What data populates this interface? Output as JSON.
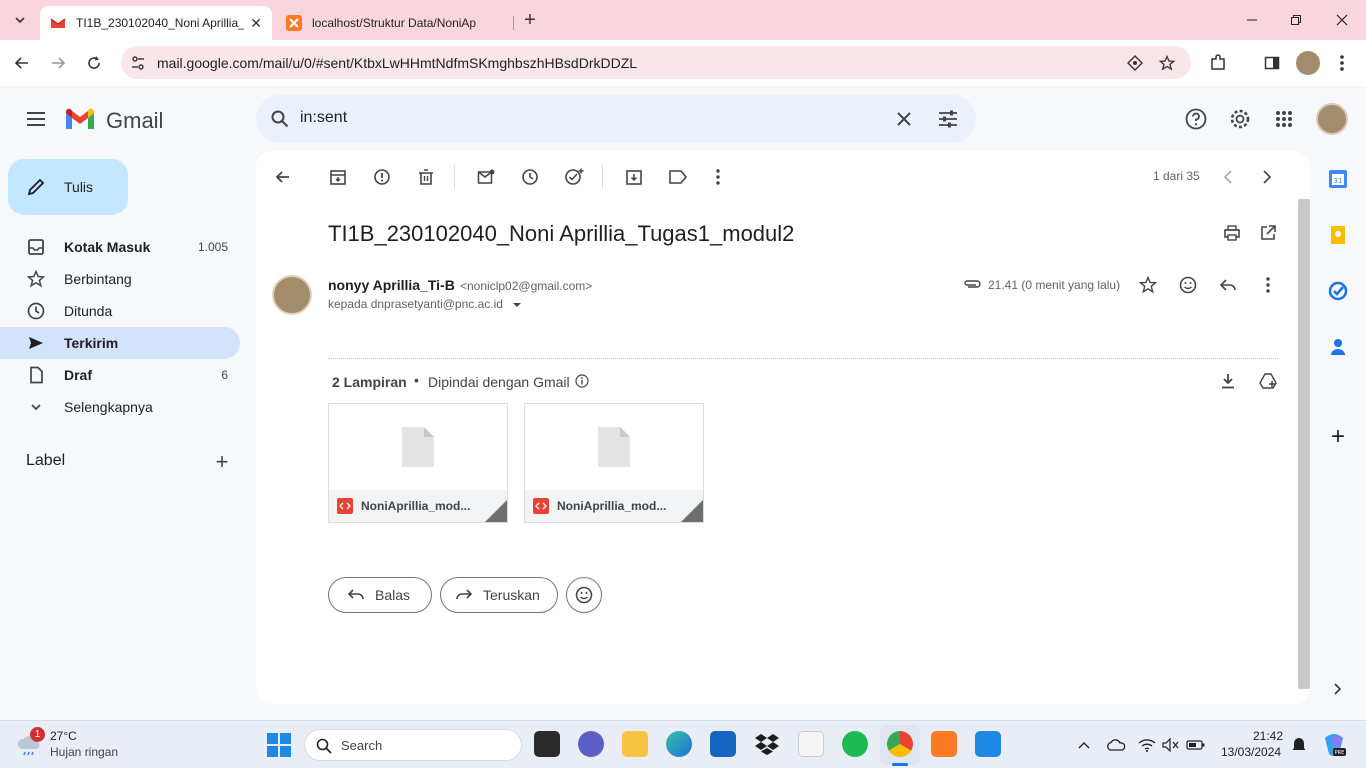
{
  "browser": {
    "tabs": [
      {
        "title": "TI1B_230102040_Noni Aprillia_T",
        "active": true
      },
      {
        "title": "localhost/Struktur Data/NoniAp",
        "active": false
      }
    ],
    "url": "mail.google.com/mail/u/0/#sent/KtbxLwHHmtNdfmSKmghbszhHBsdDrkDDZL"
  },
  "gmail": {
    "logo_text": "Gmail",
    "search_value": "in:sent",
    "compose_label": "Tulis",
    "nav": [
      {
        "label": "Kotak Masuk",
        "count": "1.005",
        "icon": "inbox-icon",
        "selected": false
      },
      {
        "label": "Berbintang",
        "count": "",
        "icon": "star-icon",
        "selected": false
      },
      {
        "label": "Ditunda",
        "count": "",
        "icon": "clock-icon",
        "selected": false
      },
      {
        "label": "Terkirim",
        "count": "",
        "icon": "send-icon",
        "selected": true
      },
      {
        "label": "Draf",
        "count": "6",
        "icon": "draft-icon",
        "selected": false
      },
      {
        "label": "Selengkapnya",
        "count": "",
        "icon": "chevron-down-icon",
        "selected": false
      }
    ],
    "labels_heading": "Label",
    "pager": "1 dari 35",
    "message": {
      "subject": "TI1B_230102040_Noni Aprillia_Tugas1_modul2",
      "sender_name": "nonyy Aprillia_Ti-B",
      "sender_email": "<noniclp02@gmail.com>",
      "to_line": "kepada dnprasetyanti@pnc.ac.id",
      "time": "21.41 (0 menit yang lalu)",
      "attachments_title": "2 Lampiran",
      "scanned_text": "Dipindai dengan Gmail",
      "attachments": [
        {
          "name": "NoniAprillia_mod..."
        },
        {
          "name": "NoniAprillia_mod..."
        }
      ],
      "reply_label": "Balas",
      "forward_label": "Teruskan"
    }
  },
  "taskbar": {
    "weather_temp": "27°C",
    "weather_desc": "Hujan ringan",
    "weather_badge": "1",
    "search_label": "Search",
    "time": "21:42",
    "date": "13/03/2024"
  },
  "colors": {
    "tabstrip": "#f9d6de",
    "omnibox": "#f9e6ea",
    "compose": "#c2e7ff",
    "selected_nav": "#d3e3fd",
    "gmail_bg": "#f6f8fc"
  }
}
